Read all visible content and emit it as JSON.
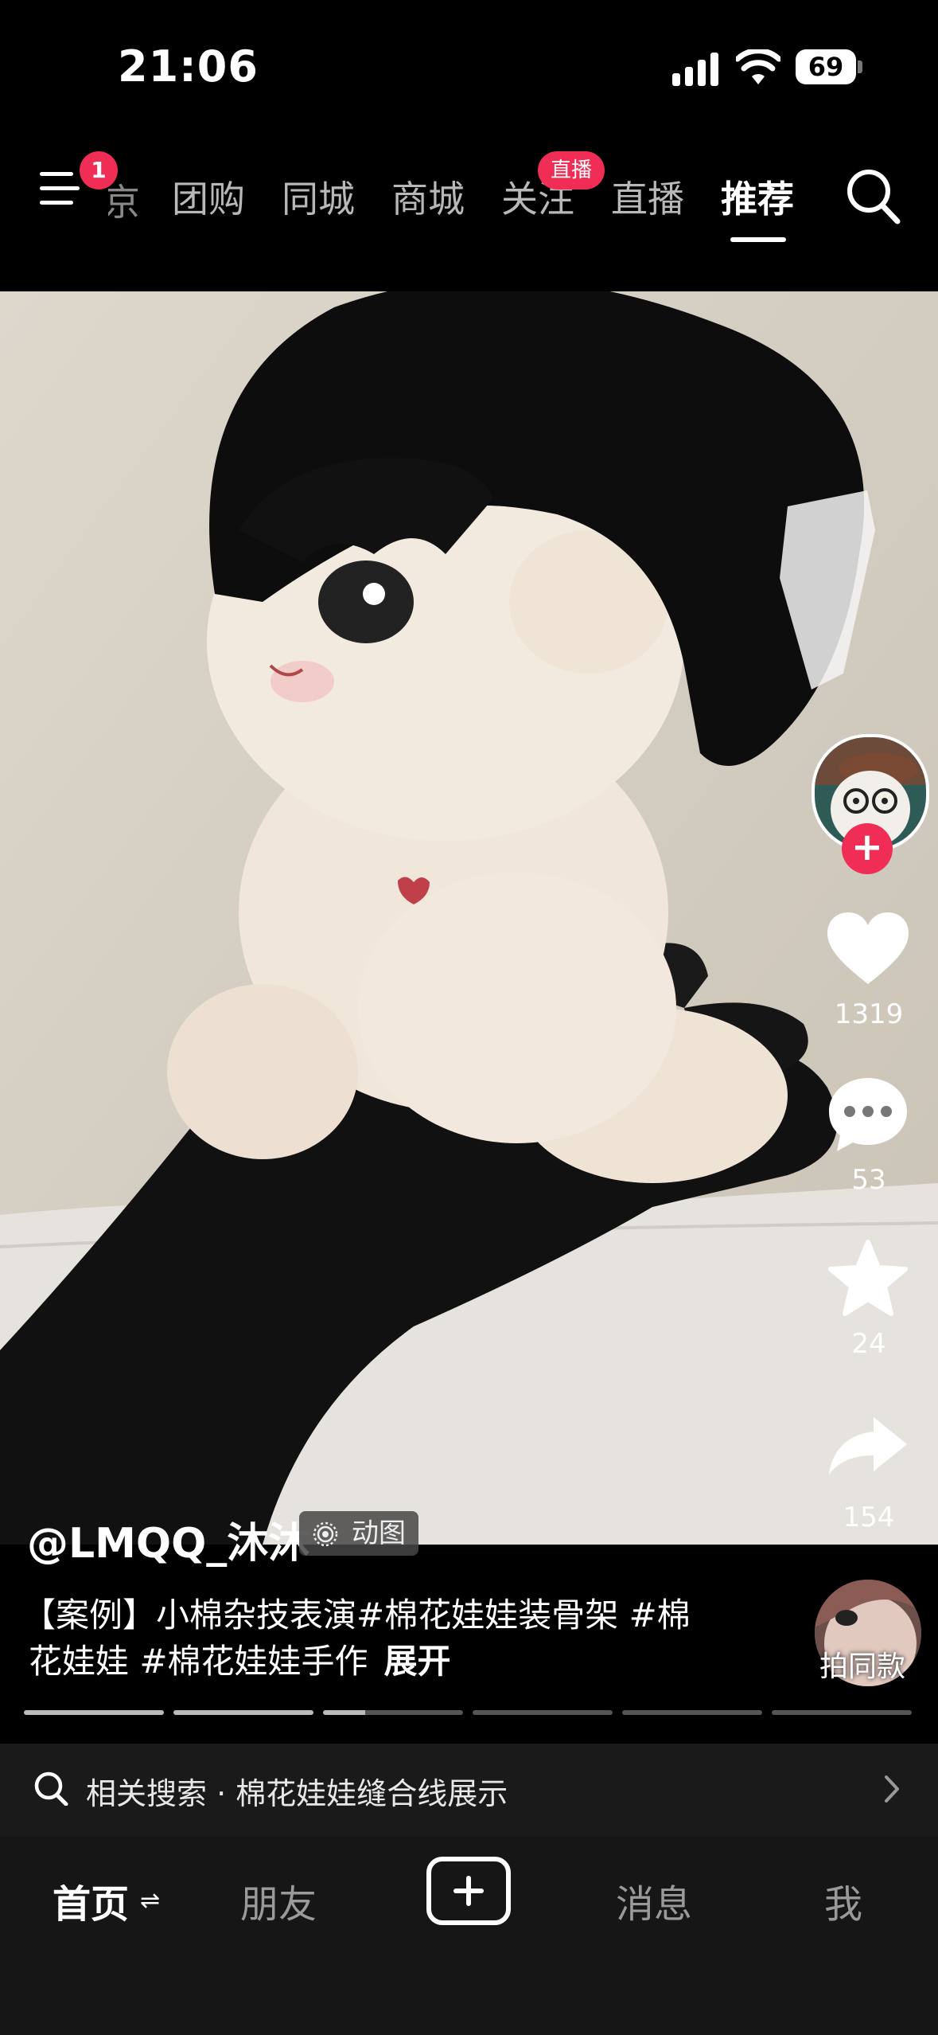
{
  "status": {
    "time": "21:06",
    "battery": "69"
  },
  "nav": {
    "menu_badge": "1",
    "partial_tab": "京",
    "tabs": [
      "团购",
      "同城",
      "商城",
      "关注",
      "直播",
      "推荐"
    ],
    "live_badge": "直播",
    "active_tab": "推荐"
  },
  "video": {
    "author": "@LMQQ_沐沐",
    "gif_tag": "动图",
    "caption_line1": "【案例】小棉杂技表演#棉花娃娃装骨架 #棉",
    "caption_line2": "花娃娃 #棉花娃娃手作",
    "expand": "展开",
    "same_style": "拍同款",
    "progress_segments": 6,
    "progress_current_segment_fraction": 0.3
  },
  "actions": {
    "likes": "1319",
    "comments": "53",
    "favorites": "24",
    "shares": "154"
  },
  "related_search": {
    "prefix": "相关搜索",
    "separator": "·",
    "query": "棉花娃娃缝合线展示"
  },
  "bottom_nav": [
    "首页",
    "朋友",
    "消息",
    "我"
  ],
  "colors": {
    "accent": "#ef2d55",
    "background": "#000000"
  }
}
